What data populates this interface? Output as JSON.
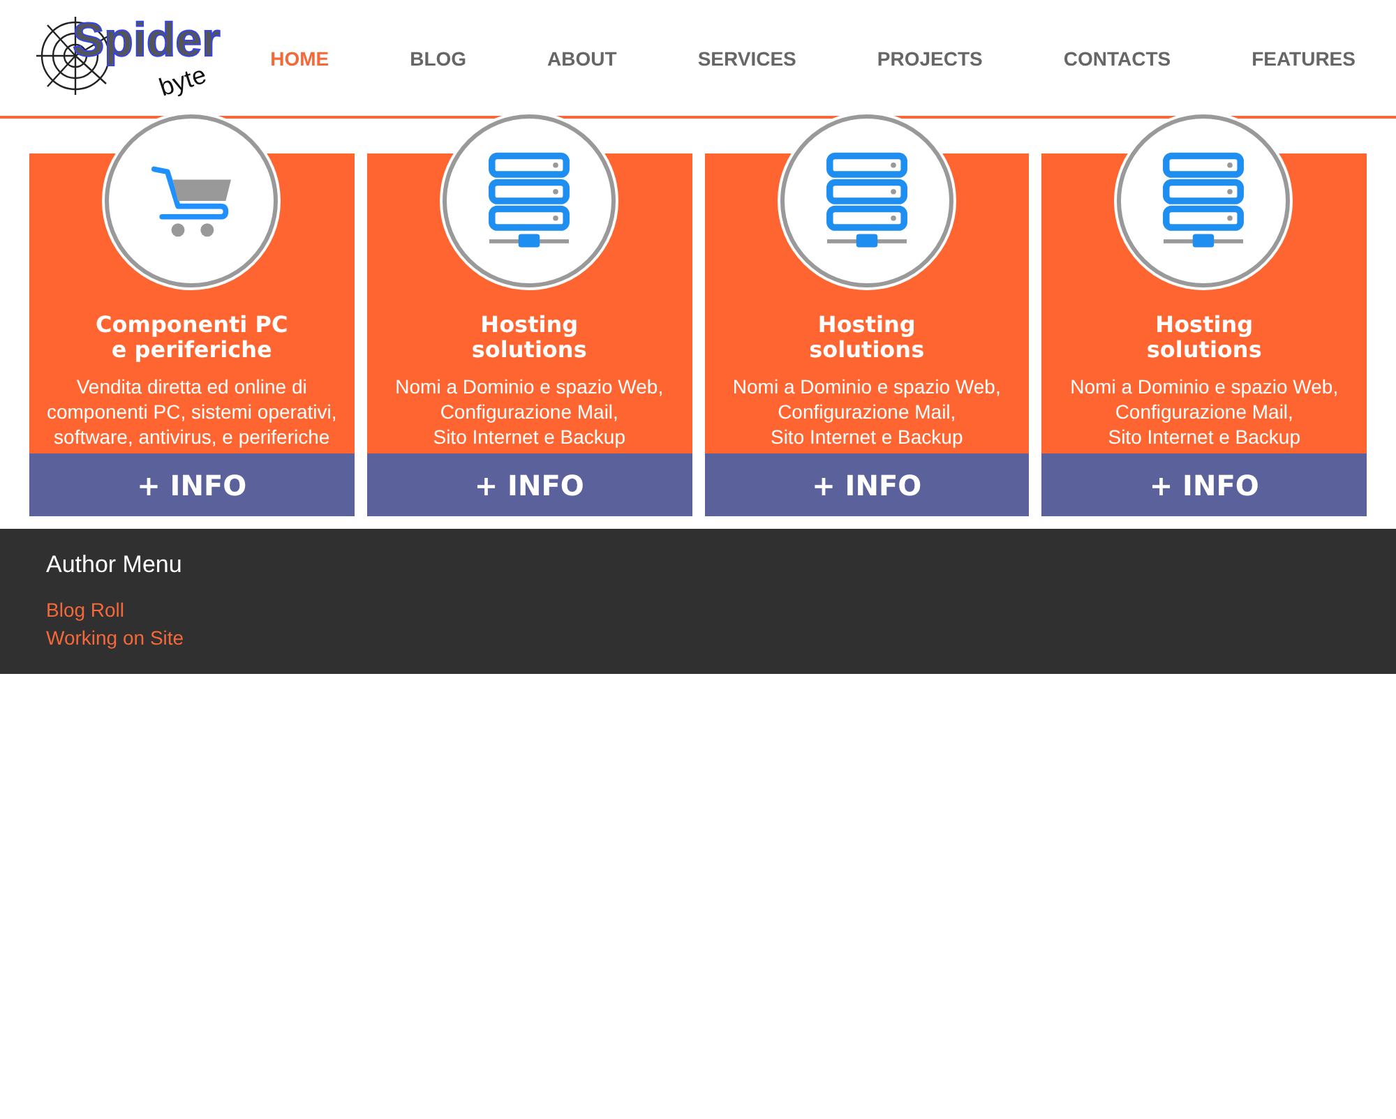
{
  "logo": {
    "word": "Spider",
    "sub": "byte"
  },
  "nav": [
    {
      "label": "HOME",
      "selected": true
    },
    {
      "label": "BLOG",
      "selected": false
    },
    {
      "label": "ABOUT",
      "selected": false
    },
    {
      "label": "SERVICES",
      "selected": false
    },
    {
      "label": "PROJECTS",
      "selected": false
    },
    {
      "label": "CONTACTS",
      "selected": false
    },
    {
      "label": "FEATURES",
      "selected": false
    }
  ],
  "cards": [
    {
      "kind": "cart",
      "title": [
        "Componenti PC",
        "e periferiche"
      ],
      "text": [
        "Vendita diretta ed online di",
        "componenti PC, sistemi operativi,",
        "software, antivirus, e periferiche"
      ],
      "button": "+ INFO"
    },
    {
      "kind": "server",
      "title": [
        "Hosting",
        "solutions"
      ],
      "text": [
        "Nomi a Dominio e spazio Web,",
        "Configurazione Mail,",
        "Sito Internet e Backup"
      ],
      "button": "+ INFO"
    },
    {
      "kind": "server",
      "title": [
        "Hosting",
        "solutions"
      ],
      "text": [
        "Nomi a Dominio e spazio Web,",
        "Configurazione Mail,",
        "Sito Internet e Backup"
      ],
      "button": "+ INFO"
    },
    {
      "kind": "server",
      "title": [
        "Hosting",
        "solutions"
      ],
      "text": [
        "Nomi a Dominio e spazio Web,",
        "Configurazione Mail,",
        "Sito Internet e Backup"
      ],
      "button": "+ INFO"
    }
  ],
  "footer": {
    "title": "Author Menu",
    "links": [
      "Blog Roll",
      "Working on Site"
    ]
  }
}
